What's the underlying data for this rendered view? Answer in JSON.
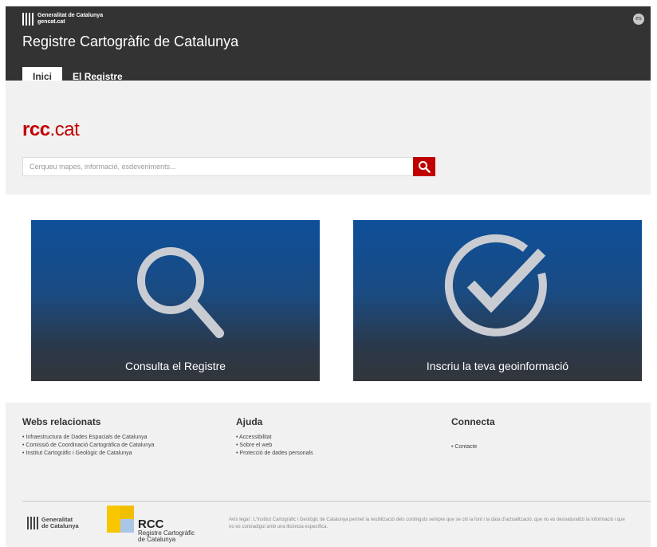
{
  "header": {
    "gencat_line1": "Generalitat de Catalunya",
    "gencat_line2": "gencat.cat",
    "lang": "es",
    "title": "Registre Cartogràfic de Catalunya",
    "tabs": [
      {
        "label": "Inici",
        "active": true
      },
      {
        "label": "El Registre",
        "active": false
      }
    ]
  },
  "hero": {
    "brand_bold": "rcc",
    "brand_light": ".cat",
    "search_placeholder": "Cerqueu mapes, informació, esdeveniments...",
    "search_icon": "search-icon"
  },
  "tiles": [
    {
      "label": "Consulta el Registre",
      "icon": "magnifier-icon"
    },
    {
      "label": "Inscriu la teva geoinformació",
      "icon": "checkmark-circle-icon"
    }
  ],
  "footer": {
    "columns": [
      {
        "title": "Webs relacionats",
        "items": [
          "Infraestructura de Dades Espacials de Catalunya",
          "Comissió de Coordinació Cartogràfica de Catalunya",
          "Institut Cartogràfic i Geològic de Catalunya"
        ]
      },
      {
        "title": "Ajuda",
        "items": [
          "Accessibilitat",
          "Sobre el web",
          "Protecció de dades personals"
        ]
      },
      {
        "title": "Connecta",
        "items": [
          "Contacte"
        ]
      }
    ],
    "gencat_line1": "Generalitat",
    "gencat_line2": "de Catalunya",
    "rcc_title": "RCC",
    "rcc_sub1": "Registre Cartogràfic",
    "rcc_sub2": "de Catalunya",
    "legal": "Avís legal : L'Institut Cartogràfic i Geològic de Catalunya permet la reutilització dels continguts sempre que se citi la font i la data d'actualització, que no es desnaturalitzi la informació i que no es contradigui amb una llicència específica."
  },
  "colors": {
    "header_bg": "#333333",
    "accent_red": "#c00000",
    "tile_blue": "#0e4f99",
    "footer_bg": "#f1f1f1"
  }
}
